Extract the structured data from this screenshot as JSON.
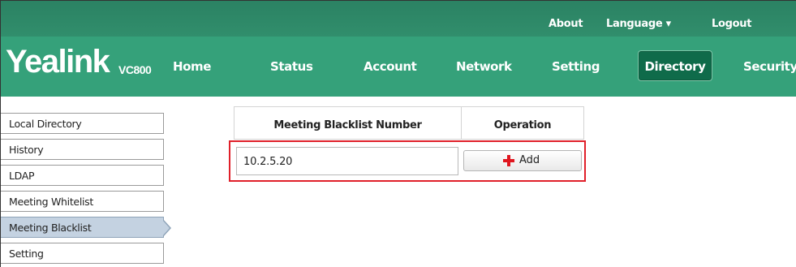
{
  "top_links": {
    "about": "About",
    "language": "Language ▾",
    "logout": "Logout"
  },
  "brand": {
    "name": "Yealink",
    "model": "VC800"
  },
  "nav": {
    "home": "Home",
    "status": "Status",
    "account": "Account",
    "network": "Network",
    "setting": "Setting",
    "directory": "Directory",
    "security": "Security",
    "active": "Directory"
  },
  "sidebar": {
    "items": [
      {
        "label": "Local Directory"
      },
      {
        "label": "History"
      },
      {
        "label": "LDAP"
      },
      {
        "label": "Meeting Whitelist"
      },
      {
        "label": "Meeting Blacklist"
      },
      {
        "label": "Setting"
      }
    ],
    "active": "Meeting Blacklist"
  },
  "blacklist_table": {
    "headers": {
      "number": "Meeting Blacklist Number",
      "operation": "Operation"
    },
    "input_value": "10.2.5.20",
    "add_button": "Add"
  },
  "colors": {
    "topbar": "#2e8b68",
    "navbar": "#35a17a",
    "nav_active": "#0f6b4a",
    "highlight_box": "#e0202a",
    "plus": "#e0161f",
    "sidebar_active": "#c4d2e1"
  }
}
